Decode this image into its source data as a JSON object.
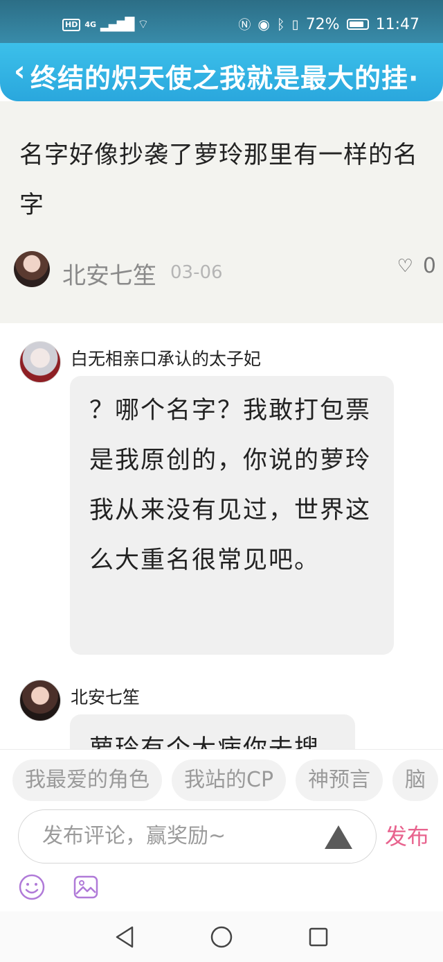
{
  "status_bar": {
    "hd": "HD",
    "network": "4G",
    "battery": "72%",
    "time": "11:47"
  },
  "header": {
    "back_glyph": "‹",
    "title": "终结的炽天使之我就是最大的挂·"
  },
  "original_comment": {
    "text": "名字好像抄袭了萝玲那里有一样的名字",
    "author": "北安七笙",
    "date": "03-06",
    "likes": "0"
  },
  "replies": [
    {
      "author": "白无相亲口承认的太子妃",
      "text": "？哪个名字？我敢打包票是我原创的，你说的萝玲我从来没有见过，世界这么大重名很常见吧。"
    },
    {
      "author": "北安七笙",
      "text": "萝玲有个大病你去搜"
    }
  ],
  "tags": [
    "我最爱的角色",
    "我站的CP",
    "神预言",
    "脑"
  ],
  "comment_input": {
    "placeholder": "发布评论，赢奖励~",
    "publish_label": "发布"
  },
  "colors": {
    "title_bar": "#2aa7dd",
    "publish": "#e8638e",
    "tool_icon": "#b07ad8"
  }
}
